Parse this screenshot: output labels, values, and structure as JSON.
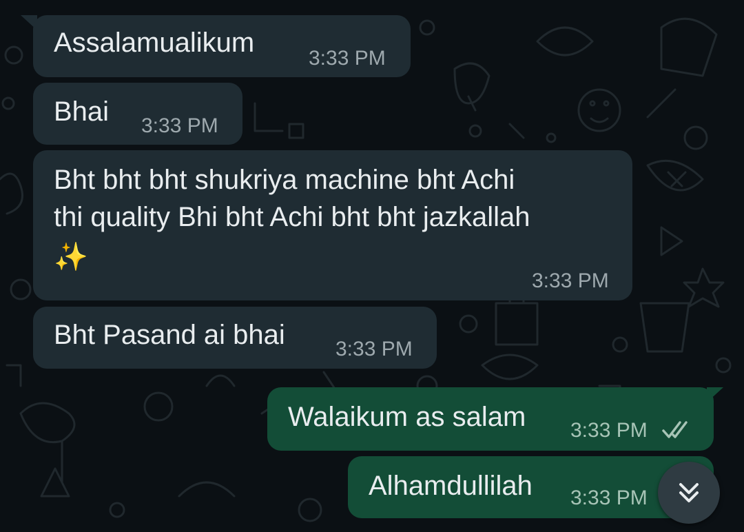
{
  "chat": {
    "messages": [
      {
        "direction": "incoming",
        "text": "Assalamualikum",
        "time": "3:33 PM"
      },
      {
        "direction": "incoming",
        "text": "Bhai",
        "time": "3:33 PM"
      },
      {
        "direction": "incoming",
        "lines": [
          "Bht bht bht shukriya machine bht Achi",
          "thi quality Bhi bht Achi bht bht jazkallah",
          "✨"
        ],
        "time": "3:33 PM"
      },
      {
        "direction": "incoming",
        "text": "Bht Pasand ai bhai",
        "time": "3:33 PM"
      },
      {
        "direction": "outgoing",
        "text": "Walaikum as salam",
        "time": "3:33 PM",
        "status": "read",
        "status_icon": "double-check-icon"
      },
      {
        "direction": "outgoing",
        "text": "Alhamdullilah",
        "time": "3:33 PM"
      }
    ],
    "scroll_button": {
      "icon": "double-chevron-down-icon"
    }
  },
  "colors": {
    "background": "#0b1014",
    "incoming_bubble": "#1f2c33",
    "outgoing_bubble": "#134d37",
    "text": "#e9edef",
    "timestamp": "#9ea9ae"
  }
}
